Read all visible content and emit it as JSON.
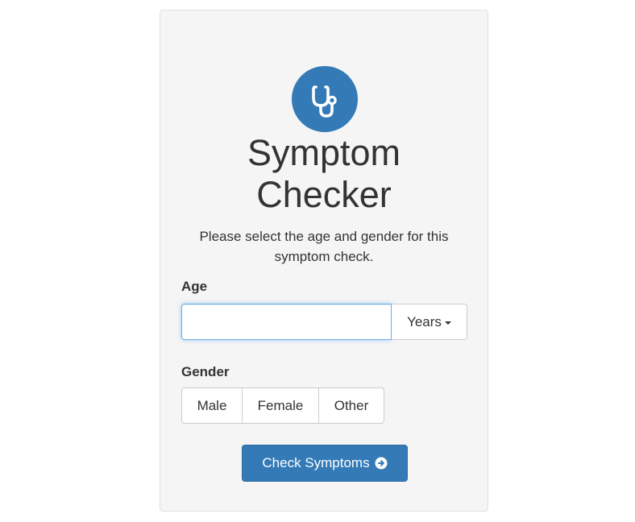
{
  "header": {
    "logo_icon": "stethoscope-icon",
    "title_line1": "Symptom",
    "title_line2": "Checker",
    "subtitle": "Please select the age and gender for this symptom check."
  },
  "age": {
    "label": "Age",
    "value": "",
    "placeholder": "",
    "unit_selected": "Years"
  },
  "gender": {
    "label": "Gender",
    "options": [
      "Male",
      "Female",
      "Other"
    ]
  },
  "actions": {
    "submit_label": "Check Symptoms",
    "submit_icon": "arrow-circle-right-icon"
  },
  "colors": {
    "primary": "#337ab7",
    "card_background": "#f5f5f5",
    "focus_border": "#66afe9"
  }
}
